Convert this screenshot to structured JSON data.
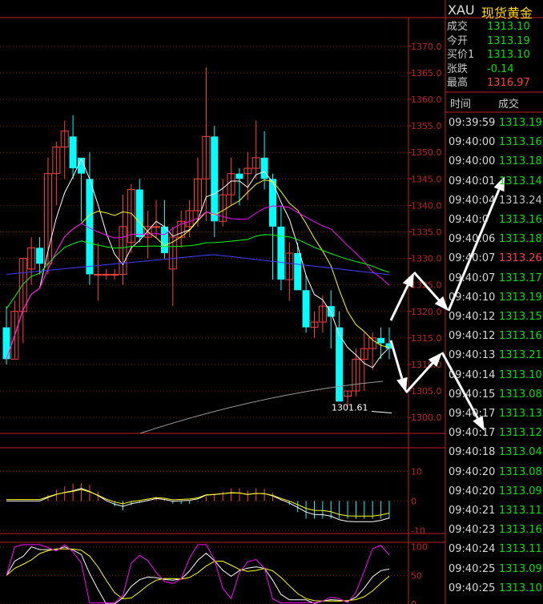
{
  "header": {
    "symbol": "XAU",
    "name": "现货黄金"
  },
  "quote": [
    {
      "label": "成交",
      "value": "1313.10",
      "color": "#00e000"
    },
    {
      "label": "今开",
      "value": "1313.19",
      "color": "#00e000"
    },
    {
      "label": "买价1",
      "value": "1313.10",
      "color": "#00e000"
    },
    {
      "label": "张跌",
      "value": "-0.14",
      "color": "#00e000"
    },
    {
      "label": "最高",
      "value": "1316.97",
      "color": "#ff4040"
    }
  ],
  "ticks_header": {
    "time": "时间",
    "price": "成交"
  },
  "ticks": [
    {
      "time": "09:39:59",
      "price": "1313.19",
      "color": "#00e000"
    },
    {
      "time": "09:40:00",
      "price": "1313.16",
      "color": "#00e000"
    },
    {
      "time": "09:40:00",
      "price": "1313.18",
      "color": "#00e000"
    },
    {
      "time": "09:40:01",
      "price": "1313.14",
      "color": "#00e000"
    },
    {
      "time": "09:40:04",
      "price": "1313.24",
      "color": "#c0c0c0"
    },
    {
      "time": "09:40:0",
      "price": "1313.16",
      "color": "#00e000"
    },
    {
      "time": "09:40:06",
      "price": "1313.18",
      "color": "#00e000"
    },
    {
      "time": "09:40:07",
      "price": "1313.26",
      "color": "#ff4040"
    },
    {
      "time": "09:40:07",
      "price": "1313.17",
      "color": "#00e000"
    },
    {
      "time": "09:40:10",
      "price": "1313.19",
      "color": "#00e000"
    },
    {
      "time": "09:40:12",
      "price": "1313.15",
      "color": "#00e000"
    },
    {
      "time": "09:40:12",
      "price": "1313.16",
      "color": "#00e000"
    },
    {
      "time": "09:40:13",
      "price": "1313.21",
      "color": "#00e000"
    },
    {
      "time": "09:40:14",
      "price": "1313.10",
      "color": "#00e000"
    },
    {
      "time": "09:40:15",
      "price": "1313.08",
      "color": "#00e000"
    },
    {
      "time": "09:40:17",
      "price": "1313.13",
      "color": "#00e000"
    },
    {
      "time": "09:40:17",
      "price": "1313.12",
      "color": "#00e000"
    },
    {
      "time": "09:40:18",
      "price": "1313.04",
      "color": "#00e000"
    },
    {
      "time": "09:40:20",
      "price": "1313.08",
      "color": "#00e000"
    },
    {
      "time": "09:40:20",
      "price": "1313.09",
      "color": "#00e000"
    },
    {
      "time": "09:40:21",
      "price": "1313.11",
      "color": "#00e000"
    },
    {
      "time": "09:40:23",
      "price": "1313.16",
      "color": "#00e000"
    },
    {
      "time": "09:40:24",
      "price": "1313.11",
      "color": "#00e000"
    },
    {
      "time": "09:40:25",
      "price": "1313.09",
      "color": "#00e000"
    },
    {
      "time": "09:40:25",
      "price": "1313.10",
      "color": "#00e000"
    }
  ],
  "colors": {
    "up": "#ff4040",
    "down": "#00ffff",
    "grid": "#7a1010",
    "axis": "#c02020",
    "flat": "#00e000"
  },
  "chart_data": [
    {
      "type": "candlestick",
      "ylim": [
        1297,
        1373
      ],
      "yticks": [
        1300,
        1305,
        1310,
        1315,
        1320,
        1325,
        1330,
        1335,
        1340,
        1345,
        1350,
        1355,
        1360,
        1365,
        1370
      ],
      "annotations": [
        {
          "text": "1301.61",
          "x": 46,
          "y": 1301.61
        }
      ],
      "candles": [
        {
          "o": 1317,
          "h": 1321,
          "l": 1310,
          "c": 1311
        },
        {
          "o": 1311,
          "h": 1322,
          "l": 1311,
          "c": 1320
        },
        {
          "o": 1320,
          "h": 1330,
          "l": 1314,
          "c": 1330
        },
        {
          "o": 1328,
          "h": 1334,
          "l": 1325,
          "c": 1332
        },
        {
          "o": 1332,
          "h": 1334,
          "l": 1327,
          "c": 1329
        },
        {
          "o": 1329,
          "h": 1349,
          "l": 1327,
          "c": 1346
        },
        {
          "o": 1346,
          "h": 1352,
          "l": 1340,
          "c": 1351
        },
        {
          "o": 1351,
          "h": 1356,
          "l": 1345,
          "c": 1354
        },
        {
          "o": 1353,
          "h": 1357,
          "l": 1345,
          "c": 1347
        },
        {
          "o": 1349,
          "h": 1347,
          "l": 1337,
          "c": 1346
        },
        {
          "o": 1345,
          "h": 1350,
          "l": 1325,
          "c": 1327
        },
        {
          "o": 1327,
          "h": 1333,
          "l": 1322,
          "c": 1327
        },
        {
          "o": 1327,
          "h": 1328,
          "l": 1326,
          "c": 1327
        },
        {
          "o": 1327,
          "h": 1328,
          "l": 1326,
          "c": 1327
        },
        {
          "o": 1327,
          "h": 1342,
          "l": 1325,
          "c": 1336
        },
        {
          "o": 1333,
          "h": 1344,
          "l": 1331,
          "c": 1343
        },
        {
          "o": 1343,
          "h": 1345,
          "l": 1333,
          "c": 1334
        },
        {
          "o": 1334,
          "h": 1339,
          "l": 1330,
          "c": 1336
        },
        {
          "o": 1336,
          "h": 1341,
          "l": 1334,
          "c": 1336
        },
        {
          "o": 1336,
          "h": 1341,
          "l": 1330,
          "c": 1331
        },
        {
          "o": 1328,
          "h": 1336,
          "l": 1321,
          "c": 1334
        },
        {
          "o": 1334,
          "h": 1339,
          "l": 1332,
          "c": 1337
        },
        {
          "o": 1336,
          "h": 1341,
          "l": 1334,
          "c": 1339
        },
        {
          "o": 1339,
          "h": 1349,
          "l": 1336,
          "c": 1345
        },
        {
          "o": 1345,
          "h": 1366,
          "l": 1337,
          "c": 1353
        },
        {
          "o": 1353,
          "h": 1355,
          "l": 1334,
          "c": 1337
        },
        {
          "o": 1337,
          "h": 1345,
          "l": 1336,
          "c": 1342
        },
        {
          "o": 1342,
          "h": 1349,
          "l": 1340,
          "c": 1346
        },
        {
          "o": 1346,
          "h": 1347,
          "l": 1340,
          "c": 1345
        },
        {
          "o": 1346,
          "h": 1350,
          "l": 1341,
          "c": 1347
        },
        {
          "o": 1347,
          "h": 1356,
          "l": 1345,
          "c": 1349
        },
        {
          "o": 1349,
          "h": 1354,
          "l": 1343,
          "c": 1345
        },
        {
          "o": 1345,
          "h": 1346,
          "l": 1326,
          "c": 1336
        },
        {
          "o": 1336,
          "h": 1340,
          "l": 1324,
          "c": 1326
        },
        {
          "o": 1326,
          "h": 1333,
          "l": 1322,
          "c": 1331
        },
        {
          "o": 1331,
          "h": 1333,
          "l": 1324,
          "c": 1324
        },
        {
          "o": 1324,
          "h": 1327,
          "l": 1316,
          "c": 1317
        },
        {
          "o": 1317,
          "h": 1320,
          "l": 1315,
          "c": 1318
        },
        {
          "o": 1318,
          "h": 1323,
          "l": 1316,
          "c": 1321
        },
        {
          "o": 1321,
          "h": 1324,
          "l": 1313,
          "c": 1319
        },
        {
          "o": 1317,
          "h": 1320,
          "l": 1303,
          "c": 1303
        },
        {
          "o": 1304,
          "h": 1305,
          "l": 1302,
          "c": 1305
        },
        {
          "o": 1305,
          "h": 1313,
          "l": 1304,
          "c": 1311
        },
        {
          "o": 1311,
          "h": 1316,
          "l": 1305,
          "c": 1313
        },
        {
          "o": 1313,
          "h": 1316,
          "l": 1309,
          "c": 1315
        },
        {
          "o": 1315,
          "h": 1317,
          "l": 1311,
          "c": 1314
        },
        {
          "o": 1314,
          "h": 1317,
          "l": 1311,
          "c": 1313
        }
      ]
    },
    {
      "type": "bar",
      "ylim": [
        -11,
        18
      ],
      "yticks": [
        10,
        0,
        -10
      ]
    },
    {
      "type": "line",
      "ylim": [
        0,
        108
      ],
      "yticks": [
        100,
        50,
        0
      ]
    }
  ]
}
